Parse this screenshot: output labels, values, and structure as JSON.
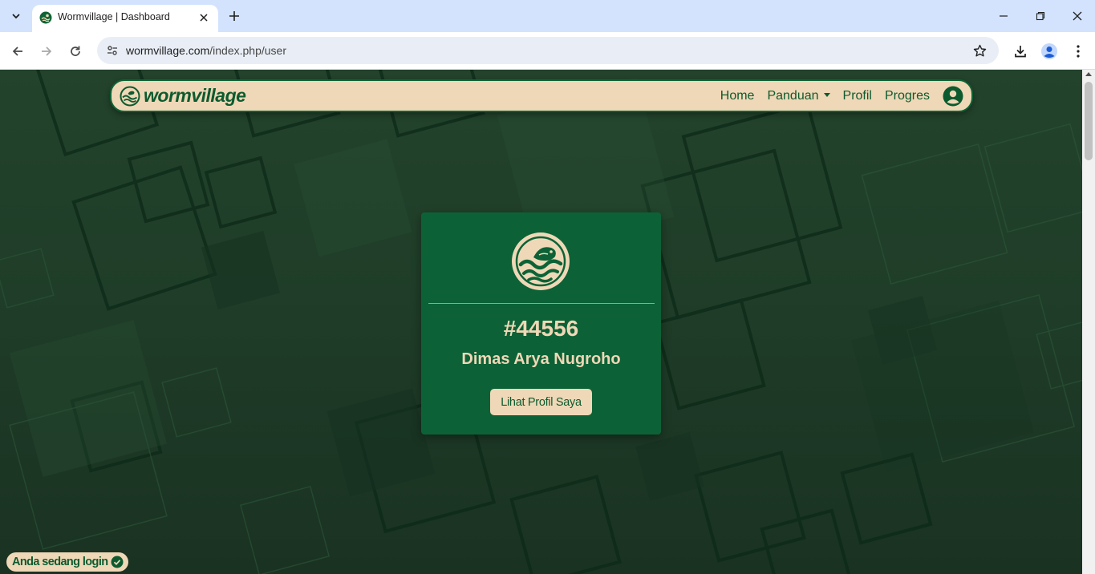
{
  "browser": {
    "tab_title": "Wormvillage | Dashboard",
    "url_host": "wormvillage.com",
    "url_path": "/index.php/user",
    "icons": [
      "tab-search-icon",
      "close-icon",
      "plus-icon",
      "minimize-icon",
      "restore-icon",
      "back-arrow-icon",
      "forward-arrow-icon",
      "reload-icon",
      "site-settings-icon",
      "star-icon",
      "download-icon",
      "profile-icon",
      "kebab-menu-icon"
    ]
  },
  "navbar": {
    "brand": "wormvillage",
    "links": [
      "Home",
      "Panduan",
      "Profil",
      "Progres"
    ]
  },
  "card": {
    "user_id": "#44556",
    "user_name": "Dimas Arya Nugroho",
    "button_label": "Lihat Profil Saya"
  },
  "status": {
    "login_text": "Anda sedang login"
  },
  "colors": {
    "brand_green": "#0d5a2f",
    "card_green": "#0c6236",
    "cream": "#efd8b7",
    "page_bg": "#1f3d28"
  }
}
